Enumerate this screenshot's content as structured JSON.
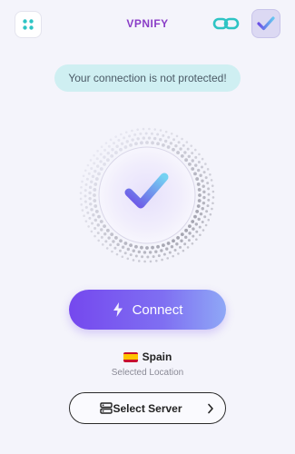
{
  "header": {
    "title": "VPNIFY",
    "menu_icon": "grid-dots-icon",
    "link_icon": "link-icon",
    "badge_icon": "check-icon"
  },
  "status": {
    "message": "Your connection is not protected!"
  },
  "shield": {
    "icon": "check-icon",
    "state": "disconnected"
  },
  "connect": {
    "label": "Connect",
    "icon": "bolt-icon"
  },
  "location": {
    "country": "Spain",
    "caption": "Selected Location",
    "flag_icon": "spain-flag-icon"
  },
  "server": {
    "label": "Select Server",
    "icon": "server-icon",
    "chevron_icon": "chevron-right-icon"
  },
  "colors": {
    "background": "#f4f4fb",
    "brand": "#8a3ec7",
    "accent_teal": "#2ec4c4",
    "status_bg": "#cfeff2",
    "connect_start": "#7548ee",
    "connect_end": "#8fa8f6"
  }
}
